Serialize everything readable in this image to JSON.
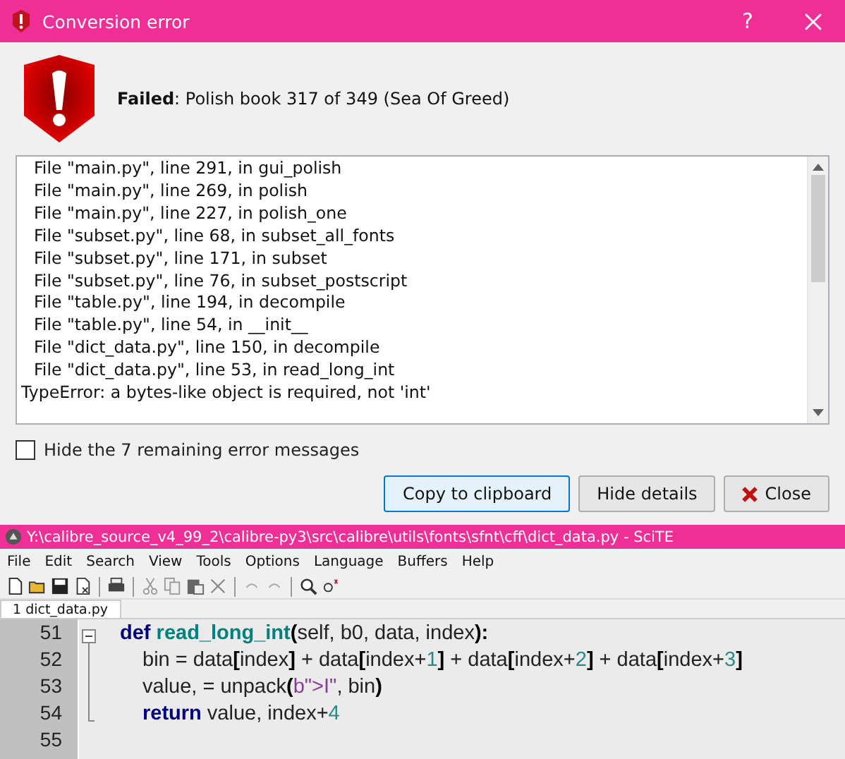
{
  "dialog": {
    "title": "Conversion error",
    "help_button": "?",
    "message": "**Failed**: Polish book 317 of 349 (Sea Of Greed)",
    "traceback": [
      {
        "kind": "frame",
        "text": "File \"main.py\", line 291, in gui_polish"
      },
      {
        "kind": "frame",
        "text": "File \"main.py\", line 269, in polish"
      },
      {
        "kind": "frame",
        "text": "File \"main.py\", line 227, in polish_one"
      },
      {
        "kind": "frame",
        "text": "File \"subset.py\", line 68, in subset_all_fonts"
      },
      {
        "kind": "frame",
        "text": "File \"subset.py\", line 171, in subset"
      },
      {
        "kind": "frame",
        "text": "File \"subset.py\", line 76, in subset_postscript"
      },
      {
        "kind": "frame",
        "text": "File \"table.py\", line 194, in decompile"
      },
      {
        "kind": "frame",
        "text": "File \"table.py\", line 54, in __init__"
      },
      {
        "kind": "frame",
        "text": "File \"dict_data.py\", line 150, in decompile"
      },
      {
        "kind": "frame",
        "text": "File \"dict_data.py\", line 53, in read_long_int"
      },
      {
        "kind": "error",
        "text": "TypeError: a bytes-like object is required, not 'int'"
      }
    ],
    "hide_checkbox": {
      "label": "Hide the 7 remaining error messages",
      "checked": false
    },
    "buttons": [
      {
        "kind": "copy",
        "label": "Copy to clipboard",
        "default": true
      },
      {
        "kind": "details",
        "label": "Hide details",
        "default": false
      },
      {
        "kind": "close",
        "label": "Close",
        "default": false
      }
    ]
  },
  "editor": {
    "title": "Y:\\calibre_source_v4_99_2\\calibre-py3\\src\\calibre\\utils\\fonts\\sfnt\\cff\\dict_data.py - SciTE",
    "menu": [
      "File",
      "Edit",
      "Search",
      "View",
      "Tools",
      "Options",
      "Language",
      "Buffers",
      "Help"
    ],
    "tab": "1 dict_data.py",
    "lines": [
      {
        "number": "51",
        "tokens": [
          {
            "kind": "keyword",
            "text": "def"
          },
          {
            "kind": "function",
            "text": "read_long_int"
          },
          {
            "kind": "op",
            "text": "("
          },
          {
            "kind": "plain",
            "text": "self, b0, data, index"
          },
          {
            "kind": "op",
            "text": "):"
          }
        ],
        "children": [
          {
            "number": "52",
            "tokens": [
              {
                "kind": "plain",
                "text": "bin = data"
              },
              {
                "kind": "op",
                "text": "["
              },
              {
                "kind": "plain",
                "text": "index"
              },
              {
                "kind": "op",
                "text": "]"
              },
              {
                "kind": "plain",
                "text": " + data"
              },
              {
                "kind": "op",
                "text": "["
              },
              {
                "kind": "plain",
                "text": "index+"
              },
              {
                "kind": "number",
                "text": "1"
              },
              {
                "kind": "op",
                "text": "]"
              },
              {
                "kind": "plain",
                "text": " + data"
              },
              {
                "kind": "op",
                "text": "["
              },
              {
                "kind": "plain",
                "text": "index+"
              },
              {
                "kind": "number",
                "text": "2"
              },
              {
                "kind": "op",
                "text": "]"
              },
              {
                "kind": "plain",
                "text": " + data"
              },
              {
                "kind": "op",
                "text": "["
              },
              {
                "kind": "plain",
                "text": "index+"
              },
              {
                "kind": "number",
                "text": "3"
              },
              {
                "kind": "op",
                "text": "]"
              }
            ]
          },
          {
            "number": "53",
            "tokens": [
              {
                "kind": "plain",
                "text": "value, = unpack"
              },
              {
                "kind": "op",
                "text": "("
              },
              {
                "kind": "string",
                "text": "b\">I\""
              },
              {
                "kind": "plain",
                "text": ", bin"
              },
              {
                "kind": "op",
                "text": ")"
              }
            ]
          },
          {
            "number": "54",
            "tokens": [
              {
                "kind": "keyword",
                "text": "return"
              },
              {
                "kind": "plain",
                "text": " value, index+"
              },
              {
                "kind": "number",
                "text": "4"
              }
            ]
          }
        ]
      },
      {
        "number": "55"
      }
    ]
  }
}
